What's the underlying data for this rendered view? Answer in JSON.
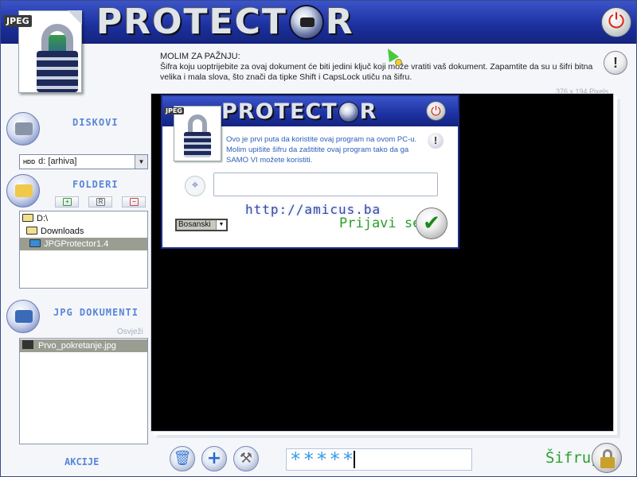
{
  "header": {
    "logo_left": "PROTECT",
    "logo_right": "R",
    "jpeg_badge": "JPEG"
  },
  "notice": {
    "title": "MOLIM ZA PAŽNJU:",
    "text": "Šifra koju uoptrijebite za ovaj dokument će biti jedini ključ koji može vratiti vaš dokument. Zapamtite da su u šifri bitna velika i mala slova, što znači da tipke Shift i CapsLock utiču na šifru.",
    "excl": "!"
  },
  "preview": {
    "pixels": "376 x 194 Pixels"
  },
  "left": {
    "disks_label": "DISKOVI",
    "drive_prefix": "HDD",
    "drive_value": "d: [arhiva]",
    "folders_label": "FOLDERI",
    "mini_buttons": [
      "+",
      "R",
      "−"
    ],
    "tree": [
      "D:\\",
      "Downloads",
      "JPGProtector1.4"
    ],
    "docs_label": "JPG DOKUMENTI",
    "refresh": "Osvježi",
    "files": [
      "Prvo_pokretanje.jpg"
    ],
    "actions_label": "AKCIJE"
  },
  "dialog": {
    "logo_left": "PROTECT",
    "logo_right": "R",
    "jpeg_badge": "JPEG",
    "text": "Ovo je prvi puta da koristite ovaj program na ovom PC-u. Molim upišite šifru da zaštitite ovaj program tako da ga SAMO VI možete koristiti.",
    "excl": "!",
    "url": "http://amicus.ba",
    "language": "Bosanski",
    "login": "Prijavi se"
  },
  "bottom": {
    "password_mask": "*****",
    "encrypt": "Šifruj"
  },
  "icons": {
    "delete": "trash-icon",
    "add": "plus-icon",
    "tools": "tools-icon",
    "power": "power-icon",
    "check": "check-icon",
    "lock": "lock-icon"
  },
  "colors": {
    "header_blue": "#1b2f9e",
    "accent_blue": "#5a86d6",
    "green": "#2aa02a",
    "power_red": "#d21111"
  }
}
